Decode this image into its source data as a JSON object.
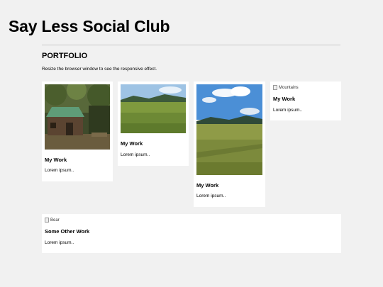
{
  "site": {
    "title": "Say Less Social Club"
  },
  "section": {
    "title": "PORTFOLIO",
    "subtitle": "Resize the browser window to see the responsive effect."
  },
  "cards": [
    {
      "image": "cabin-photo",
      "title": "My Work",
      "text": "Lorem ipsum.."
    },
    {
      "image": "meadow-photo",
      "title": "My Work",
      "text": "Lorem ipsum.."
    },
    {
      "image": "field-sky-photo",
      "title": "My Work",
      "text": "Lorem ipsum.."
    },
    {
      "image_alt": "Mountains",
      "title": "My Work",
      "text": "Lorem ipsum.."
    },
    {
      "image_alt": "Bear",
      "title": "Some Other Work",
      "text": "Lorem ipsum.."
    }
  ],
  "colors": {
    "page_bg": "#f1f1f1",
    "card_bg": "#ffffff",
    "divider": "#c8c8c8"
  }
}
